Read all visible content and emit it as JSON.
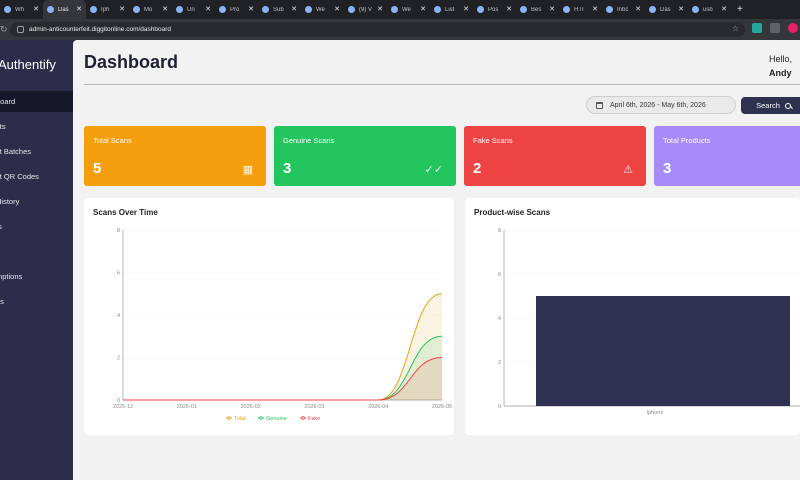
{
  "browser": {
    "tabs": [
      {
        "label": "Wh",
        "active": false
      },
      {
        "label": "Das",
        "active": true
      },
      {
        "label": "Iph",
        "active": false
      },
      {
        "label": "Mo",
        "active": false
      },
      {
        "label": "Un",
        "active": false
      },
      {
        "label": "Pro",
        "active": false
      },
      {
        "label": "Sub",
        "active": false
      },
      {
        "label": "We",
        "active": false
      },
      {
        "label": "(9) V",
        "active": false
      },
      {
        "label": "We",
        "active": false
      },
      {
        "label": "List",
        "active": false
      },
      {
        "label": "Pos",
        "active": false
      },
      {
        "label": "Bes",
        "active": false
      },
      {
        "label": "HTI",
        "active": false
      },
      {
        "label": "Inbc",
        "active": false
      },
      {
        "label": "Das",
        "active": false
      },
      {
        "label": "usb",
        "active": false
      }
    ],
    "url": "admin-anticounterfeit.diggitonline.com/dashboard"
  },
  "sidebar": {
    "brand": "Authentify",
    "items": [
      {
        "label": "board",
        "active": true
      },
      {
        "label": "cts",
        "active": false
      },
      {
        "label": "ct Batches",
        "active": false
      },
      {
        "label": "ct QR Codes",
        "active": false
      },
      {
        "label": "History",
        "active": false
      },
      {
        "label": "ts",
        "active": false
      },
      {
        "label": "",
        "active": false
      },
      {
        "label": "mptions",
        "active": false
      },
      {
        "label": "gs",
        "active": false
      }
    ]
  },
  "header": {
    "title": "Dashboard",
    "greeting": "Hello,",
    "user": "Andy"
  },
  "filters": {
    "date_range": "April 6th, 2026 - May 6th, 2026",
    "search_label": "Search"
  },
  "cards": [
    {
      "label": "Total Scans",
      "value": "5",
      "color": "#f59e0b",
      "icon": "qr-code-icon"
    },
    {
      "label": "Genuine Scans",
      "value": "3",
      "color": "#22c55e",
      "icon": "double-check-icon"
    },
    {
      "label": "Fake Scans",
      "value": "2",
      "color": "#ef4444",
      "icon": "warning-icon"
    },
    {
      "label": "Total Products",
      "value": "3",
      "color": "#a78bfa",
      "icon": ""
    }
  ],
  "panels": {
    "scans_title": "Scans Over Time",
    "product_title": "Product-wise Scans"
  },
  "chart_data": [
    {
      "type": "line",
      "title": "Scans Over Time",
      "x": [
        "2025-12",
        "2026-01",
        "2026-02",
        "2026-03",
        "2026-04",
        "2026-05"
      ],
      "ylim": [
        0,
        8
      ],
      "yticks": [
        0,
        2,
        4,
        6,
        8
      ],
      "grid": true,
      "legend": "bottom",
      "series": [
        {
          "name": "Total",
          "color": "#e8a317",
          "values": [
            0,
            0,
            0,
            0,
            0,
            5
          ]
        },
        {
          "name": "Genuine",
          "color": "#22c55e",
          "values": [
            0,
            0,
            0,
            0,
            0,
            3
          ]
        },
        {
          "name": "Fake",
          "color": "#ef4444",
          "values": [
            0,
            0,
            0,
            0,
            0,
            2
          ]
        }
      ]
    },
    {
      "type": "bar",
      "title": "Product-wise Scans",
      "categories": [
        "Iphone"
      ],
      "values": [
        5
      ],
      "ylim": [
        0,
        8
      ],
      "yticks": [
        0,
        2,
        4,
        6,
        8
      ],
      "color": "#2e3150"
    }
  ]
}
